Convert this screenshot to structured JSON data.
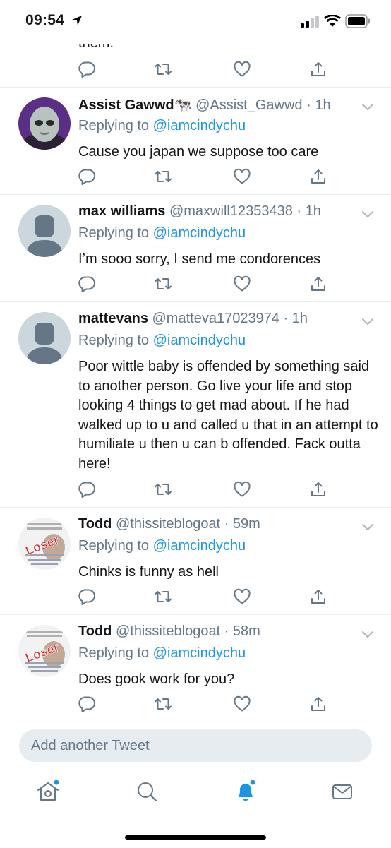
{
  "status_bar": {
    "time": "09:54"
  },
  "partial_tweet": {
    "text": "them."
  },
  "tweets": [
    {
      "name": "Assist Gawwd",
      "name_emoji": "🐄",
      "handle": "@Assist_Gawwd",
      "dot": "·",
      "time": "1h",
      "replying_label": "Replying to",
      "mention": "@iamcindychu",
      "text": "Cause you japan we suppose too care",
      "avatar": "alien-photo"
    },
    {
      "name": "max williams",
      "name_emoji": "",
      "handle": "@maxwill12353438",
      "dot": "·",
      "time": "1h",
      "replying_label": "Replying to",
      "mention": "@iamcindychu",
      "text": "I’m sooo sorry, I send me condorences",
      "avatar": "default-egg"
    },
    {
      "name": "mattevans",
      "name_emoji": "",
      "handle": "@matteva17023974",
      "dot": "·",
      "time": "1h",
      "replying_label": "Replying to",
      "mention": "@iamcindychu",
      "text": "Poor wittle baby is offended by something said to another person. Go live your life and stop looking 4 things to get mad about. If he had walked up to u and called u that in an attempt to humiliate u then u can b offended. Fack outta here!",
      "avatar": "default-egg"
    },
    {
      "name": "Todd",
      "name_emoji": "",
      "handle": "@thissiteblogoat",
      "dot": "·",
      "time": "59m",
      "replying_label": "Replying to",
      "mention": "@iamcindychu",
      "text": "Chinks is funny as hell",
      "avatar": "loser-stamp",
      "avatar_stamp": "Loser"
    },
    {
      "name": "Todd",
      "name_emoji": "",
      "handle": "@thissiteblogoat",
      "dot": "·",
      "time": "58m",
      "replying_label": "Replying to",
      "mention": "@iamcindychu",
      "text": "Does gook work for you?",
      "avatar": "loser-stamp",
      "avatar_stamp": "Loser"
    }
  ],
  "compose": {
    "placeholder": "Add another Tweet"
  },
  "tabs": [
    "home-icon",
    "search-icon",
    "notifications-icon",
    "messages-icon"
  ],
  "colors": {
    "accent": "#1b95e0",
    "secondary_text": "#657786",
    "divider": "#e6ecf0",
    "primary_text": "#14171a"
  }
}
